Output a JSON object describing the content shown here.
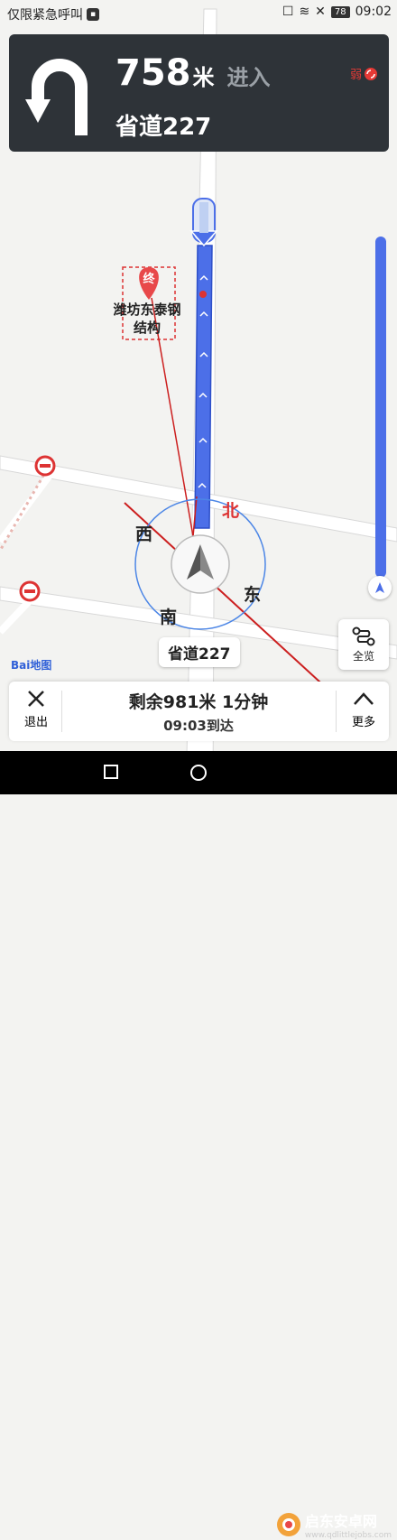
{
  "status_bar": {
    "left_text": "仅限紧急呼叫",
    "battery": "78",
    "time": "09:02"
  },
  "guidance": {
    "distance": "758",
    "distance_unit": "米",
    "action": "进入",
    "road": "省道227",
    "signal_label": "弱"
  },
  "map": {
    "destination_marker": "终",
    "destination_name_line1": "潍坊东泰钢",
    "destination_name_line2": "结构",
    "current_road": "省道227",
    "compass": {
      "north": "北",
      "south": "南",
      "east": "东",
      "west": "西"
    },
    "logo_text": "Bai地图",
    "route_color": "#4c6fe8",
    "annotation_color": "#cc1f1f"
  },
  "controls": {
    "overview_label": "全览"
  },
  "bottom_bar": {
    "exit_label": "退出",
    "remaining": "剩余981米 1分钟",
    "eta": "09:03到达",
    "more_label": "更多"
  },
  "watermark": {
    "title": "启东安卓网",
    "url": "www.qdlittlejobs.com"
  }
}
